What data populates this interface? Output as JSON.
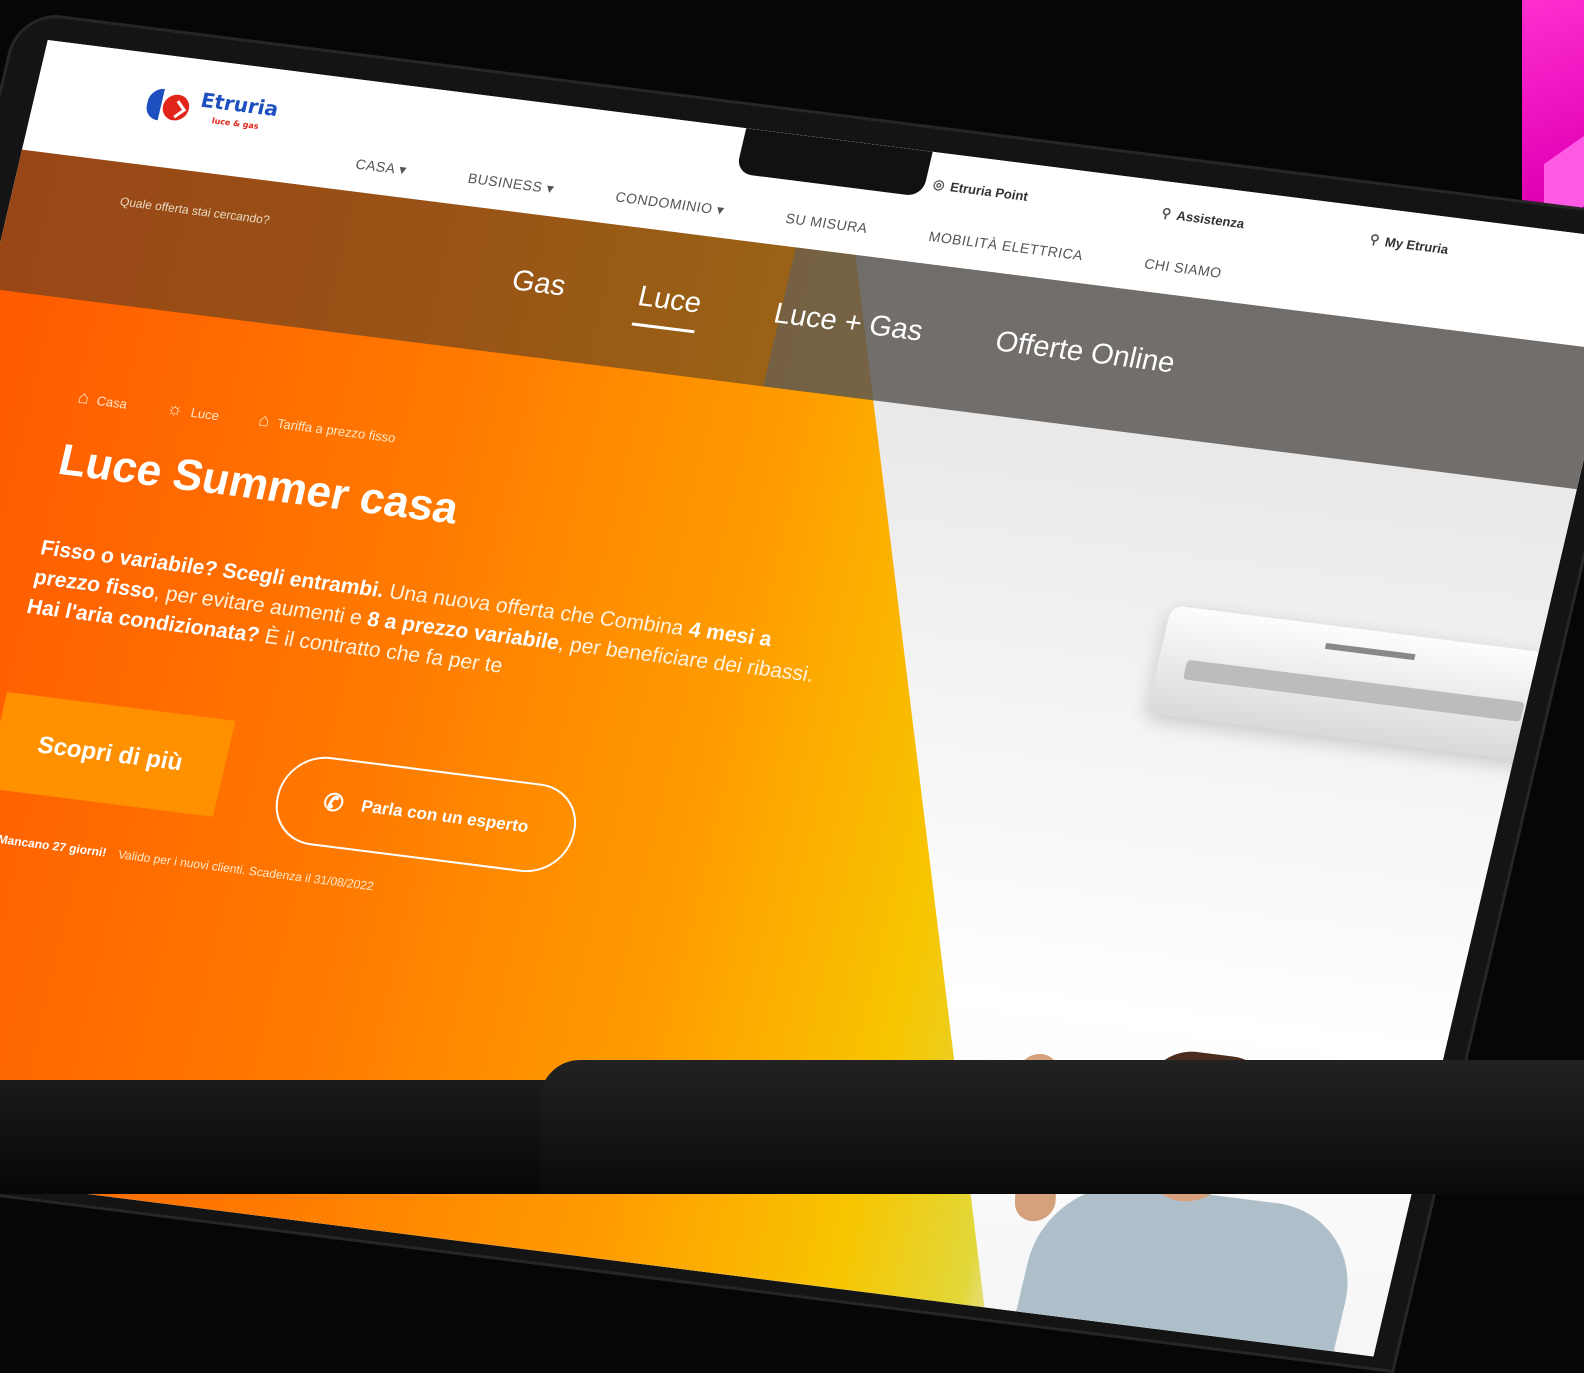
{
  "brand": {
    "name": "Etruria",
    "sub": "luce & gas",
    "blue": "#1e4fbf",
    "red": "#e1251b"
  },
  "utility": {
    "point": "Etruria Point",
    "assistenza": "Assistenza",
    "account": "My Etruria"
  },
  "nav": [
    "CASA ▾",
    "BUSINESS ▾",
    "CONDOMINIO ▾",
    "SU MISURA",
    "MOBILITÀ ELETTRICA",
    "CHI SIAMO"
  ],
  "question": "Quale offerta stai cercando?",
  "subnav": [
    "Gas",
    "Luce",
    "Luce + Gas",
    "Offerte Online"
  ],
  "subnav_active": "Luce",
  "crumbs": [
    "Casa",
    "Luce",
    "Tariffa a prezzo fisso"
  ],
  "hero": {
    "title": "Luce Summer casa",
    "desc_1": "Fisso o variabile? Scegli entrambi.",
    "desc_2": " Una nuova offerta che Combina ",
    "desc_3": "4 mesi a prezzo fisso",
    "desc_4": ", per evitare aumenti e ",
    "desc_5": "8 a prezzo variabile",
    "desc_6": ", per beneficiare dei ribassi. ",
    "desc_7": "Hai l'aria condizionata?",
    "desc_8": "È il contratto che fa per te",
    "cta_primary": "Scopri di più",
    "cta_secondary": "Parla con un esperto",
    "deadline_bold": "Mancano 27 giorni!",
    "deadline_text": "Valido per i nuovi clienti. Scadenza il 31/08/2022",
    "accent_orange": "#ff9100"
  }
}
